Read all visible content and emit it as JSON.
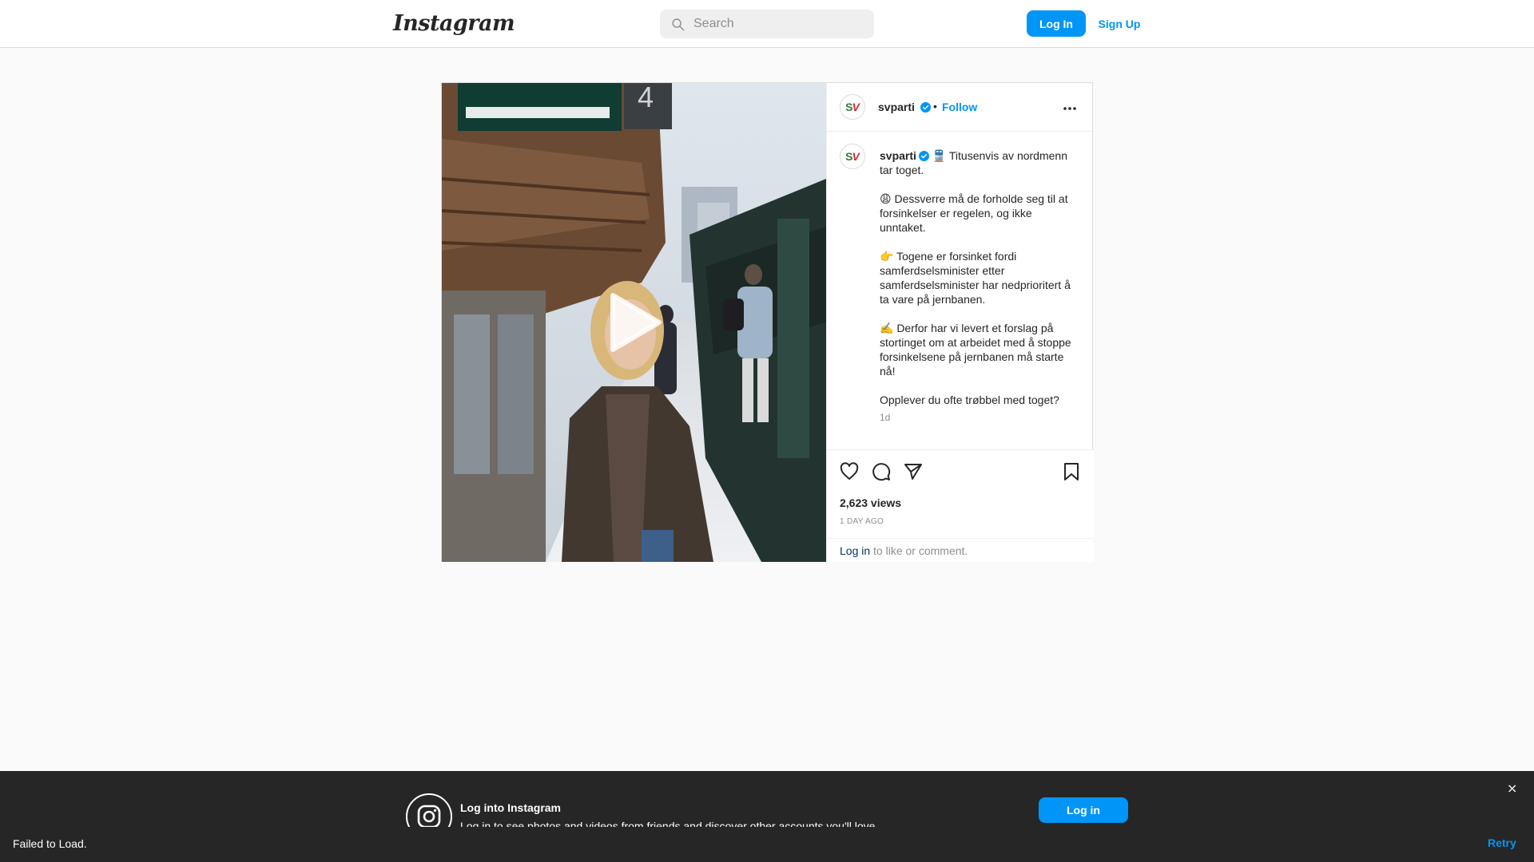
{
  "header": {
    "logo_text": "Instagram",
    "search_placeholder": "Search",
    "login_label": "Log In",
    "signup_label": "Sign Up"
  },
  "post": {
    "username": "svparti",
    "follow_label": "Follow",
    "separator": "•",
    "caption_lines": [
      "🚆 Titusenvis av nordmenn tar toget.",
      "😩 Dessverre må de forholde seg til at forsinkelser er regelen, og ikke unntaket.",
      "👉 Togene er forsinket fordi samferdselsminister etter samferdselsminister har nedprioritert å ta vare på jernbanen.",
      "✍️ Derfor har vi levert et forslag på stortinget om at arbeidet med å stoppe forsinkelsene på jernbanen må starte nå!",
      "Opplever du ofte trøbbel med toget?"
    ],
    "caption_time": "1d",
    "video_overlay_number": "4",
    "views": "2,623 views",
    "time_ago": "1 DAY AGO",
    "login_link": "Log in",
    "login_suffix": " to like or comment."
  },
  "banner": {
    "title": "Log into Instagram",
    "subtitle": "Log in to see photos and videos from friends and discover other accounts you'll love.",
    "login_label": "Log in",
    "close_label": "×"
  },
  "toast": {
    "message": "Failed to Load.",
    "retry_label": "Retry"
  },
  "colors": {
    "accent": "#0095f6",
    "verified": "#0095f6",
    "banner_bg": "#262626"
  }
}
